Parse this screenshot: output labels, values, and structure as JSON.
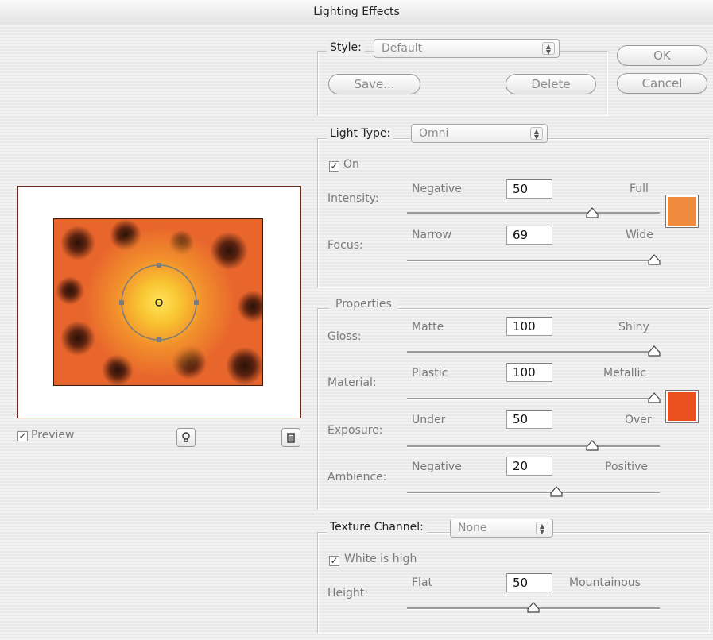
{
  "window": {
    "title": "Lighting Effects"
  },
  "style_section": {
    "label": "Style:",
    "selected": "Default",
    "save_label": "Save...",
    "delete_label": "Delete"
  },
  "buttons": {
    "ok": "OK",
    "cancel": "Cancel"
  },
  "light_type": {
    "label": "Light Type:",
    "selected": "Omni",
    "on_label": "On",
    "on_checked": true,
    "intensity": {
      "label": "Intensity:",
      "min_label": "Negative",
      "max_label": "Full",
      "value": "50",
      "range": [
        -100,
        100
      ]
    },
    "focus": {
      "label": "Focus:",
      "min_label": "Narrow",
      "max_label": "Wide",
      "value": "69",
      "range": [
        -100,
        100
      ]
    },
    "light_color": "#f08a3c"
  },
  "properties": {
    "title": "Properties",
    "gloss": {
      "label": "Gloss:",
      "min_label": "Matte",
      "max_label": "Shiny",
      "value": "100",
      "range": [
        -100,
        100
      ]
    },
    "material": {
      "label": "Material:",
      "min_label": "Plastic",
      "max_label": "Metallic",
      "value": "100",
      "range": [
        -100,
        100
      ]
    },
    "exposure": {
      "label": "Exposure:",
      "min_label": "Under",
      "max_label": "Over",
      "value": "50",
      "range": [
        -100,
        100
      ]
    },
    "ambience": {
      "label": "Ambience:",
      "min_label": "Negative",
      "max_label": "Positive",
      "value": "20",
      "range": [
        -100,
        100
      ]
    },
    "ambient_color": "#ea4f1e"
  },
  "texture": {
    "label": "Texture Channel:",
    "selected": "None",
    "white_is_high_label": "White is high",
    "white_is_high_checked": true,
    "height": {
      "label": "Height:",
      "min_label": "Flat",
      "max_label": "Mountainous",
      "value": "50",
      "range": [
        0,
        100
      ]
    }
  },
  "preview": {
    "label": "Preview",
    "checked": true,
    "new_light_icon": "lightbulb-icon",
    "delete_light_icon": "trash-icon"
  }
}
